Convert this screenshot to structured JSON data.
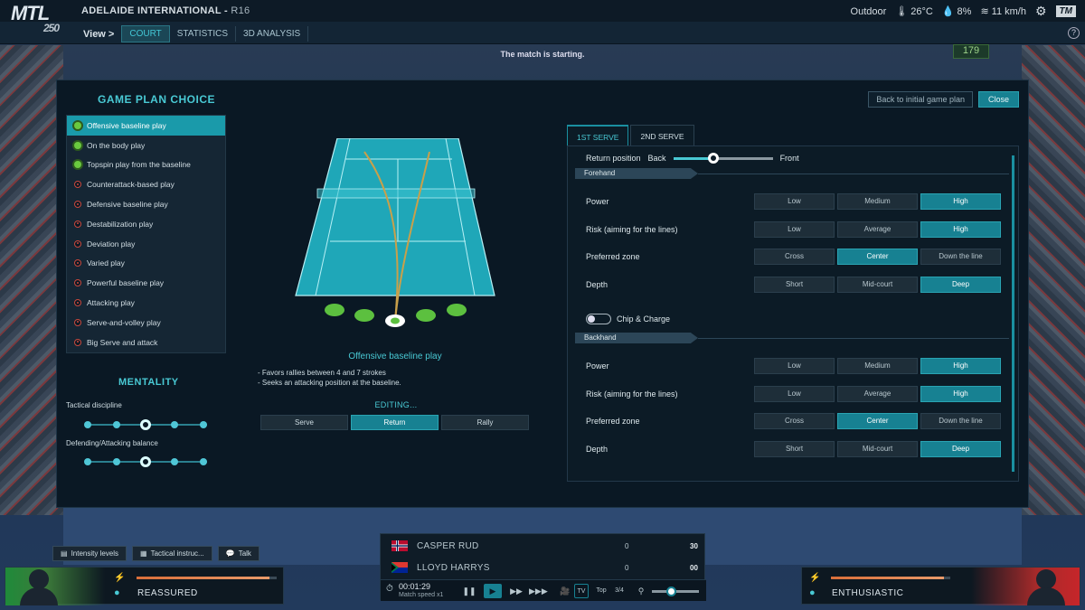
{
  "header": {
    "logo_text": "MTL",
    "logo_sub": "250",
    "tournament": "ADELAIDE INTERNATIONAL",
    "round": "R16",
    "weather": {
      "condition": "Outdoor",
      "temp": "26°C",
      "humidity": "8%",
      "wind": "11 km/h"
    },
    "tm_label": "TM"
  },
  "nav": {
    "view_label": "View >",
    "tabs": [
      "COURT",
      "STATISTICS",
      "3D ANALYSIS"
    ],
    "active_tab": "COURT",
    "help": "?"
  },
  "court_status": {
    "message": "The match is starting.",
    "speed": "179"
  },
  "game_plan": {
    "title": "GAME PLAN CHOICE",
    "back_label": "Back to initial game plan",
    "close_label": "Close",
    "plans": [
      {
        "label": "Offensive baseline play",
        "status": "green",
        "active": true
      },
      {
        "label": "On the body play",
        "status": "green"
      },
      {
        "label": "Topspin play from the baseline",
        "status": "green"
      },
      {
        "label": "Counterattack-based play",
        "status": "red"
      },
      {
        "label": "Defensive baseline play",
        "status": "red"
      },
      {
        "label": "Destabilization play",
        "status": "red"
      },
      {
        "label": "Deviation play",
        "status": "red"
      },
      {
        "label": "Varied play",
        "status": "red"
      },
      {
        "label": "Powerful baseline play",
        "status": "red"
      },
      {
        "label": "Attacking play",
        "status": "red"
      },
      {
        "label": "Serve-and-volley play",
        "status": "red"
      },
      {
        "label": "Big Serve and attack",
        "status": "red"
      }
    ],
    "selected_name": "Offensive baseline play",
    "description": [
      "- Favors rallies between 4 and 7 strokes",
      "- Seeks an attacking position at the baseline."
    ],
    "editing_label": "EDITING...",
    "edit_tabs": [
      "Serve",
      "Return",
      "Rally"
    ],
    "edit_active": "Return"
  },
  "mentality": {
    "title": "MENTALITY",
    "tactical_discipline": {
      "label": "Tactical discipline",
      "level": 3,
      "steps": 5
    },
    "balance": {
      "label": "Defending/Attacking balance",
      "level": 3,
      "steps": 5
    }
  },
  "serve_panel": {
    "tabs": [
      "1ST SERVE",
      "2ND SERVE"
    ],
    "active_tab": "1ST SERVE",
    "return_position": {
      "label": "Return position",
      "back": "Back",
      "front": "Front",
      "value_fraction": 0.4
    },
    "chip_charge": "Chip & Charge",
    "sections": [
      {
        "title": "Forehand",
        "rows": [
          {
            "label": "Power",
            "options": [
              "Low",
              "Medium",
              "High"
            ],
            "selected": "High"
          },
          {
            "label": "Risk (aiming for the lines)",
            "options": [
              "Low",
              "Average",
              "High"
            ],
            "selected": "High"
          },
          {
            "label": "Preferred zone",
            "options": [
              "Cross",
              "Center",
              "Down the line"
            ],
            "selected": "Center"
          },
          {
            "label": "Depth",
            "options": [
              "Short",
              "Mid-court",
              "Deep"
            ],
            "selected": "Deep"
          }
        ]
      },
      {
        "title": "Backhand",
        "rows": [
          {
            "label": "Power",
            "options": [
              "Low",
              "Medium",
              "High"
            ],
            "selected": "High"
          },
          {
            "label": "Risk (aiming for the lines)",
            "options": [
              "Low",
              "Average",
              "High"
            ],
            "selected": "High"
          },
          {
            "label": "Preferred zone",
            "options": [
              "Cross",
              "Center",
              "Down the line"
            ],
            "selected": "Center"
          },
          {
            "label": "Depth",
            "options": [
              "Short",
              "Mid-court",
              "Deep"
            ],
            "selected": "Deep"
          }
        ]
      }
    ]
  },
  "bottom": {
    "tabs": [
      "Intensity levels",
      "Tactical instruc...",
      "Talk"
    ],
    "left_mood": "REASSURED",
    "right_mood": "ENTHUSIASTIC",
    "left_energy": 0.95,
    "right_energy": 0.95
  },
  "scoreboard": {
    "players": [
      {
        "name": "CASPER RUD",
        "games": "0",
        "points": "30"
      },
      {
        "name": "LLOYD HARRYS",
        "games": "0",
        "points": "00"
      }
    ],
    "time": "00:01:29",
    "speed_label": "Match speed x1",
    "view_tv": "TV",
    "view_top": "Top",
    "view_34": "3/4"
  },
  "colors": {
    "accent": "#49c9d4",
    "active": "#178192",
    "green": "#6ac93f",
    "red": "#c8483d"
  }
}
